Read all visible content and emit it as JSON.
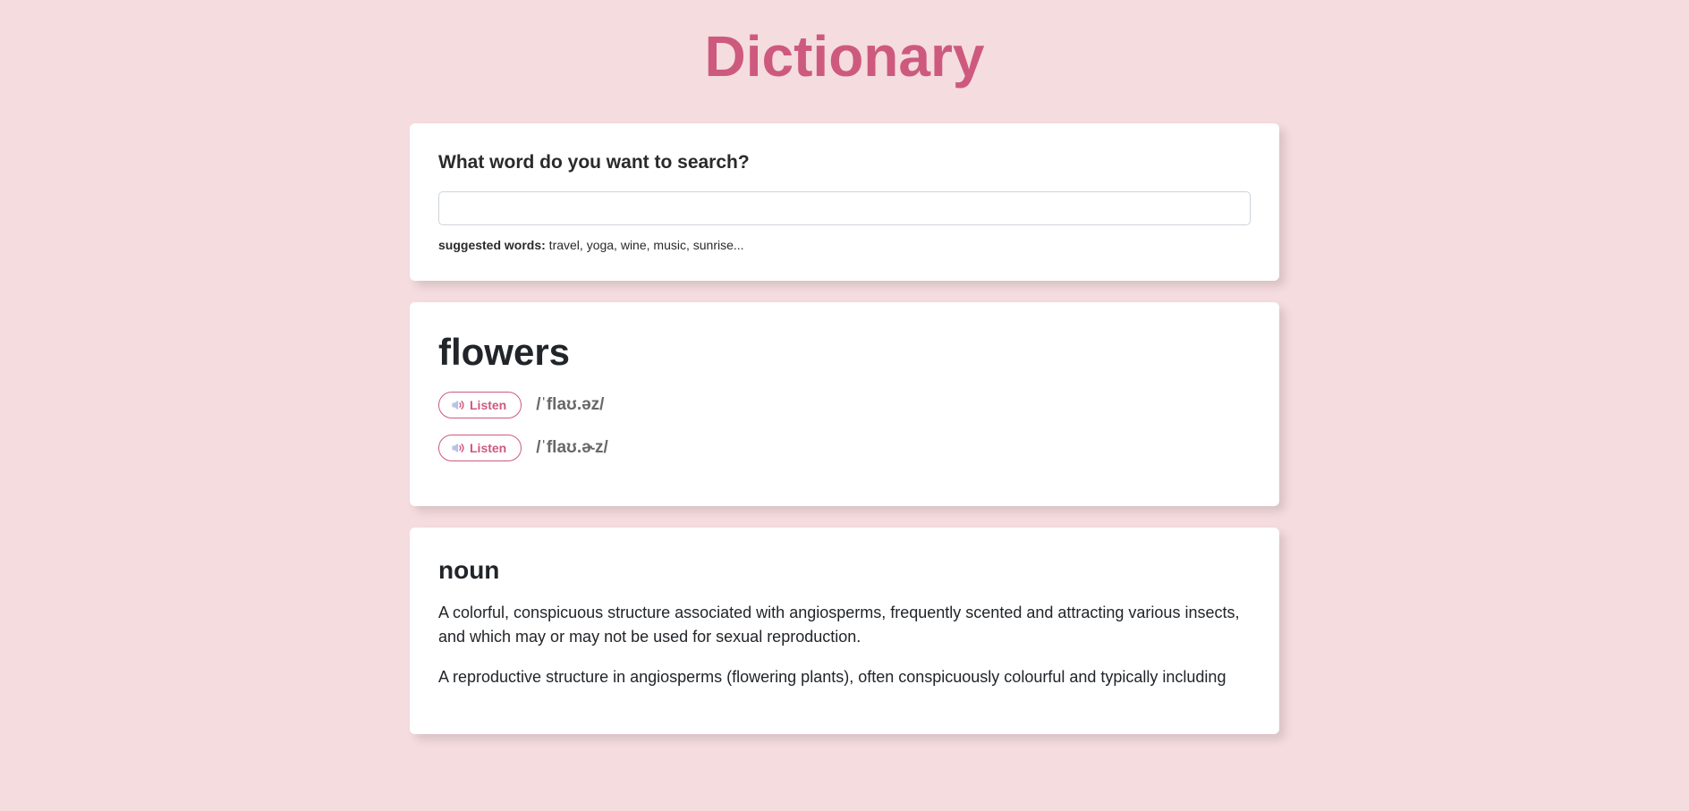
{
  "header": {
    "title": "Dictionary"
  },
  "search": {
    "label": "What word do you want to search?",
    "value": "",
    "suggested_label": "suggested words:",
    "suggested_text": " travel, yoga, wine, music, sunrise..."
  },
  "word": {
    "term": "flowers",
    "phonetics": [
      {
        "listen_label": "Listen",
        "text": "/ˈflaʊ.əz/"
      },
      {
        "listen_label": "Listen",
        "text": "/ˈflaʊ.ɚz/"
      }
    ]
  },
  "definition_section": {
    "part_of_speech": "noun",
    "definitions": [
      "A colorful, conspicuous structure associated with angiosperms, frequently scented and attracting various insects, and which may or may not be used for sexual reproduction.",
      "A reproductive structure in angiosperms (flowering plants), often conspicuously colourful and typically including"
    ]
  }
}
